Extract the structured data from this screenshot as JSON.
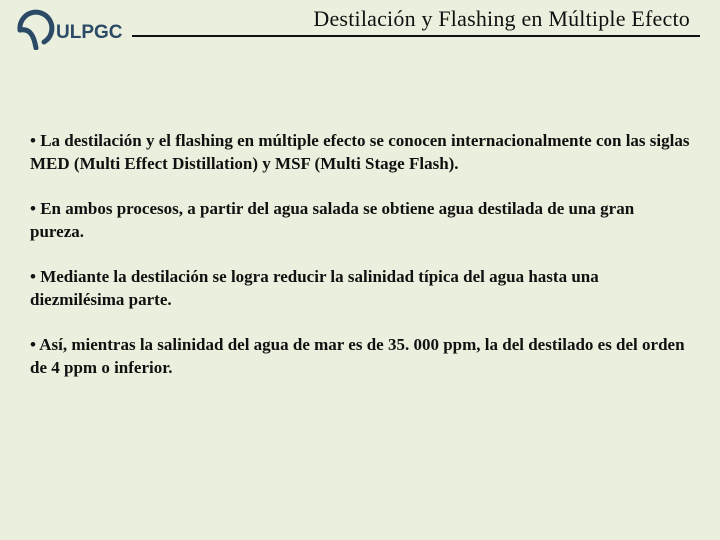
{
  "header": {
    "logo_text": "ULPGC",
    "title": "Destilación y Flashing en Múltiple Efecto"
  },
  "bullets": {
    "b1": "La destilación y el flashing en múltiple efecto se conocen internacionalmente con las siglas MED (Multi Effect Distillation) y MSF (Multi Stage Flash).",
    "b2": "En ambos procesos, a partir del agua salada se obtiene agua destilada de una gran pureza.",
    "b3": "Mediante la destilación se logra reducir la salinidad típica del agua hasta una diezmilésima parte.",
    "b4": "Así, mientras la salinidad del agua de mar es de 35. 000 ppm, la del destilado es del orden de 4 ppm o inferior."
  }
}
